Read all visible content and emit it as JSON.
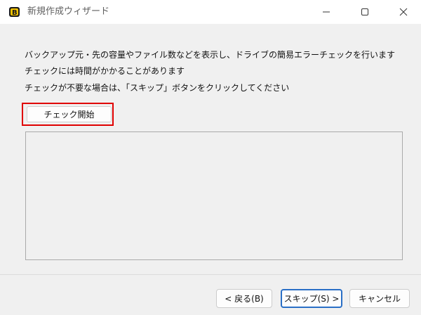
{
  "window": {
    "title": "新規作成ウィザード",
    "icon": "app-logo-icon"
  },
  "messages": [
    "バックアップ元・先の容量やファイル数などを表示し、ドライブの簡易エラーチェックを行います",
    "チェックには時間がかかることがあります",
    "チェックが不要な場合は、「スキップ」ボタンをクリックしてください"
  ],
  "check_button_label": "チェック開始",
  "footer": {
    "back_label": "< 戻る(B)",
    "skip_label": "スキップ(S) >",
    "cancel_label": "キャンセル"
  },
  "colors": {
    "highlight": "#e00000",
    "default_button_border": "#2a6fc6"
  }
}
